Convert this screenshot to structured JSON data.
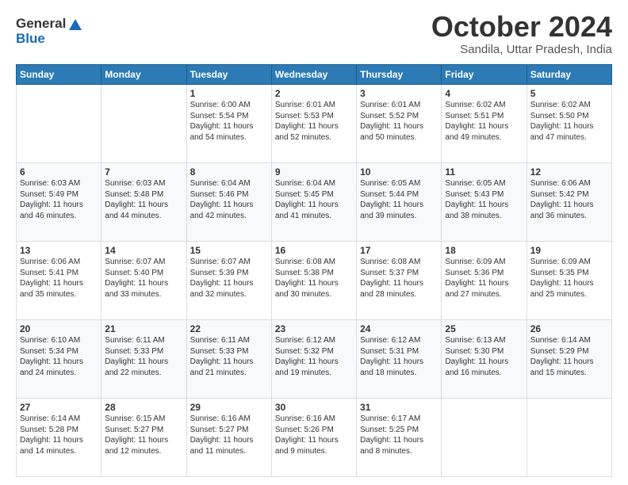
{
  "logo": {
    "line1": "General",
    "line2": "Blue"
  },
  "header": {
    "month": "October 2024",
    "location": "Sandila, Uttar Pradesh, India"
  },
  "days_of_week": [
    "Sunday",
    "Monday",
    "Tuesday",
    "Wednesday",
    "Thursday",
    "Friday",
    "Saturday"
  ],
  "weeks": [
    [
      {
        "day": "",
        "sunrise": "",
        "sunset": "",
        "daylight": ""
      },
      {
        "day": "",
        "sunrise": "",
        "sunset": "",
        "daylight": ""
      },
      {
        "day": "1",
        "sunrise": "Sunrise: 6:00 AM",
        "sunset": "Sunset: 5:54 PM",
        "daylight": "Daylight: 11 hours and 54 minutes."
      },
      {
        "day": "2",
        "sunrise": "Sunrise: 6:01 AM",
        "sunset": "Sunset: 5:53 PM",
        "daylight": "Daylight: 11 hours and 52 minutes."
      },
      {
        "day": "3",
        "sunrise": "Sunrise: 6:01 AM",
        "sunset": "Sunset: 5:52 PM",
        "daylight": "Daylight: 11 hours and 50 minutes."
      },
      {
        "day": "4",
        "sunrise": "Sunrise: 6:02 AM",
        "sunset": "Sunset: 5:51 PM",
        "daylight": "Daylight: 11 hours and 49 minutes."
      },
      {
        "day": "5",
        "sunrise": "Sunrise: 6:02 AM",
        "sunset": "Sunset: 5:50 PM",
        "daylight": "Daylight: 11 hours and 47 minutes."
      }
    ],
    [
      {
        "day": "6",
        "sunrise": "Sunrise: 6:03 AM",
        "sunset": "Sunset: 5:49 PM",
        "daylight": "Daylight: 11 hours and 46 minutes."
      },
      {
        "day": "7",
        "sunrise": "Sunrise: 6:03 AM",
        "sunset": "Sunset: 5:48 PM",
        "daylight": "Daylight: 11 hours and 44 minutes."
      },
      {
        "day": "8",
        "sunrise": "Sunrise: 6:04 AM",
        "sunset": "Sunset: 5:46 PM",
        "daylight": "Daylight: 11 hours and 42 minutes."
      },
      {
        "day": "9",
        "sunrise": "Sunrise: 6:04 AM",
        "sunset": "Sunset: 5:45 PM",
        "daylight": "Daylight: 11 hours and 41 minutes."
      },
      {
        "day": "10",
        "sunrise": "Sunrise: 6:05 AM",
        "sunset": "Sunset: 5:44 PM",
        "daylight": "Daylight: 11 hours and 39 minutes."
      },
      {
        "day": "11",
        "sunrise": "Sunrise: 6:05 AM",
        "sunset": "Sunset: 5:43 PM",
        "daylight": "Daylight: 11 hours and 38 minutes."
      },
      {
        "day": "12",
        "sunrise": "Sunrise: 6:06 AM",
        "sunset": "Sunset: 5:42 PM",
        "daylight": "Daylight: 11 hours and 36 minutes."
      }
    ],
    [
      {
        "day": "13",
        "sunrise": "Sunrise: 6:06 AM",
        "sunset": "Sunset: 5:41 PM",
        "daylight": "Daylight: 11 hours and 35 minutes."
      },
      {
        "day": "14",
        "sunrise": "Sunrise: 6:07 AM",
        "sunset": "Sunset: 5:40 PM",
        "daylight": "Daylight: 11 hours and 33 minutes."
      },
      {
        "day": "15",
        "sunrise": "Sunrise: 6:07 AM",
        "sunset": "Sunset: 5:39 PM",
        "daylight": "Daylight: 11 hours and 32 minutes."
      },
      {
        "day": "16",
        "sunrise": "Sunrise: 6:08 AM",
        "sunset": "Sunset: 5:38 PM",
        "daylight": "Daylight: 11 hours and 30 minutes."
      },
      {
        "day": "17",
        "sunrise": "Sunrise: 6:08 AM",
        "sunset": "Sunset: 5:37 PM",
        "daylight": "Daylight: 11 hours and 28 minutes."
      },
      {
        "day": "18",
        "sunrise": "Sunrise: 6:09 AM",
        "sunset": "Sunset: 5:36 PM",
        "daylight": "Daylight: 11 hours and 27 minutes."
      },
      {
        "day": "19",
        "sunrise": "Sunrise: 6:09 AM",
        "sunset": "Sunset: 5:35 PM",
        "daylight": "Daylight: 11 hours and 25 minutes."
      }
    ],
    [
      {
        "day": "20",
        "sunrise": "Sunrise: 6:10 AM",
        "sunset": "Sunset: 5:34 PM",
        "daylight": "Daylight: 11 hours and 24 minutes."
      },
      {
        "day": "21",
        "sunrise": "Sunrise: 6:11 AM",
        "sunset": "Sunset: 5:33 PM",
        "daylight": "Daylight: 11 hours and 22 minutes."
      },
      {
        "day": "22",
        "sunrise": "Sunrise: 6:11 AM",
        "sunset": "Sunset: 5:33 PM",
        "daylight": "Daylight: 11 hours and 21 minutes."
      },
      {
        "day": "23",
        "sunrise": "Sunrise: 6:12 AM",
        "sunset": "Sunset: 5:32 PM",
        "daylight": "Daylight: 11 hours and 19 minutes."
      },
      {
        "day": "24",
        "sunrise": "Sunrise: 6:12 AM",
        "sunset": "Sunset: 5:31 PM",
        "daylight": "Daylight: 11 hours and 18 minutes."
      },
      {
        "day": "25",
        "sunrise": "Sunrise: 6:13 AM",
        "sunset": "Sunset: 5:30 PM",
        "daylight": "Daylight: 11 hours and 16 minutes."
      },
      {
        "day": "26",
        "sunrise": "Sunrise: 6:14 AM",
        "sunset": "Sunset: 5:29 PM",
        "daylight": "Daylight: 11 hours and 15 minutes."
      }
    ],
    [
      {
        "day": "27",
        "sunrise": "Sunrise: 6:14 AM",
        "sunset": "Sunset: 5:28 PM",
        "daylight": "Daylight: 11 hours and 14 minutes."
      },
      {
        "day": "28",
        "sunrise": "Sunrise: 6:15 AM",
        "sunset": "Sunset: 5:27 PM",
        "daylight": "Daylight: 11 hours and 12 minutes."
      },
      {
        "day": "29",
        "sunrise": "Sunrise: 6:16 AM",
        "sunset": "Sunset: 5:27 PM",
        "daylight": "Daylight: 11 hours and 11 minutes."
      },
      {
        "day": "30",
        "sunrise": "Sunrise: 6:16 AM",
        "sunset": "Sunset: 5:26 PM",
        "daylight": "Daylight: 11 hours and 9 minutes."
      },
      {
        "day": "31",
        "sunrise": "Sunrise: 6:17 AM",
        "sunset": "Sunset: 5:25 PM",
        "daylight": "Daylight: 11 hours and 8 minutes."
      },
      {
        "day": "",
        "sunrise": "",
        "sunset": "",
        "daylight": ""
      },
      {
        "day": "",
        "sunrise": "",
        "sunset": "",
        "daylight": ""
      }
    ]
  ]
}
